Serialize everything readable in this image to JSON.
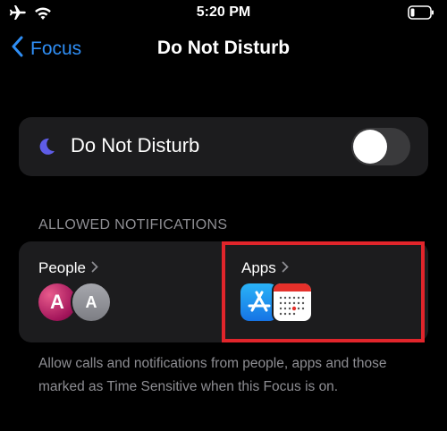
{
  "status_bar": {
    "time": "5:20 PM",
    "icons": [
      "airplane-icon",
      "wifi-icon",
      "battery-icon"
    ]
  },
  "nav": {
    "back_label": "Focus",
    "title": "Do Not Disturb"
  },
  "dnd_toggle": {
    "label": "Do Not Disturb",
    "icon": "moon-icon",
    "state": "off"
  },
  "allowed": {
    "header": "ALLOWED NOTIFICATIONS",
    "people": {
      "label": "People",
      "avatars": [
        {
          "initial": "A",
          "color": "#c21e6d"
        },
        {
          "initial": "A",
          "color": "#8e8e93"
        }
      ]
    },
    "apps": {
      "label": "Apps",
      "icons": [
        "app-store-icon",
        "calendar-icon"
      ]
    }
  },
  "footer": {
    "text": "Allow calls and notifications from people, apps and those marked as Time Sensitive when this Focus is on."
  },
  "colors": {
    "accent": "#2f8ef5",
    "highlight": "#e1252b",
    "card": "#1c1c1e",
    "moon": "#5e5ce6"
  }
}
